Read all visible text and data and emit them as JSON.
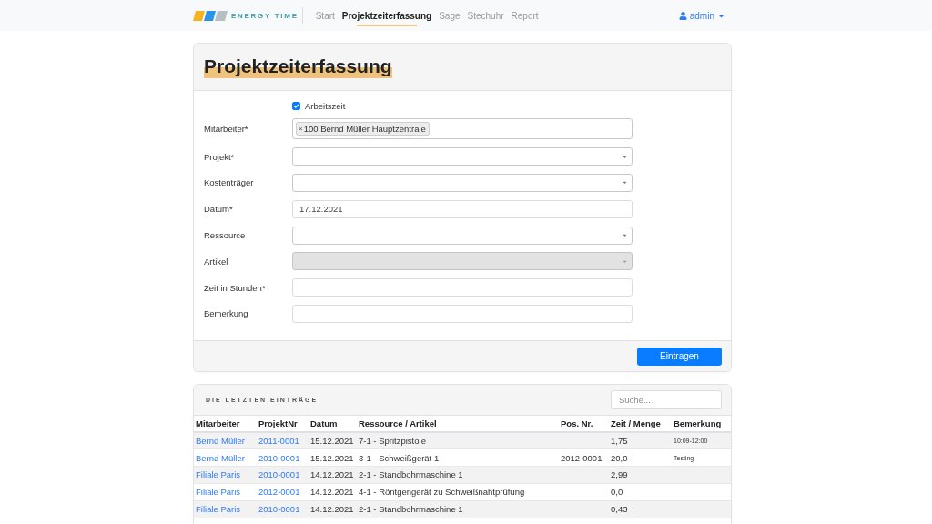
{
  "navbar": {
    "brand": "ENERGY TIME",
    "links": [
      {
        "label": "Start",
        "selected": false
      },
      {
        "label": "Projektzeiterfassung",
        "selected": true
      },
      {
        "label": "Sage",
        "selected": false
      },
      {
        "label": "Stechuhr",
        "selected": false
      },
      {
        "label": "Report",
        "selected": false
      }
    ],
    "user": "admin"
  },
  "form": {
    "title": "Projektzeiterfassung",
    "checkbox": {
      "label": "Arbeitszeit",
      "checked": true
    },
    "fields": [
      {
        "label": "Mitarbeiter*",
        "kind": "tags",
        "disabled": false,
        "tags": [
          {
            "remove": "×",
            "label": "100 Bernd Müller Hauptzentrale"
          }
        ]
      },
      {
        "label": "Projekt*",
        "kind": "select",
        "disabled": false
      },
      {
        "label": "Kostenträger",
        "kind": "select",
        "disabled": false
      },
      {
        "label": "Datum*",
        "kind": "text",
        "disabled": false,
        "value": "17.12.2021"
      },
      {
        "label": "Ressource",
        "kind": "select",
        "disabled": false
      },
      {
        "label": "Artikel",
        "kind": "select",
        "disabled": true
      },
      {
        "label": "Zeit in Stunden*",
        "kind": "text",
        "disabled": false
      },
      {
        "label": "Bemerkung",
        "kind": "text",
        "disabled": false
      }
    ],
    "submit": "Eintragen"
  },
  "recent": {
    "title": "DIE LETZTEN EINTRÄGE",
    "search": {
      "placeholder": "Suche..."
    },
    "table": {
      "columns": [
        {
          "label": "Mitarbeiter",
          "kind": "link"
        },
        {
          "label": "ProjektNr",
          "kind": "link"
        },
        {
          "label": "Datum",
          "kind": "text"
        },
        {
          "label": "Ressource / Artikel",
          "kind": "text"
        },
        {
          "label": "Pos. Nr.",
          "kind": "text"
        },
        {
          "label": "Zeit / Menge",
          "kind": "text"
        },
        {
          "label": "Bemerkung",
          "kind": "note"
        }
      ],
      "rows": [
        {
          "mitarbeiter": "Bernd Müller",
          "projekt_nr": "2011-0001",
          "datum": "15.12.2021",
          "ressource_artikel": "7-1 - Spritzpistole",
          "zeit_menge": "1,75",
          "bemerkung": "10:09-12:00"
        },
        {
          "mitarbeiter": "Bernd Müller",
          "projekt_nr": "2010-0001",
          "datum": "15.12.2021",
          "ressource_artikel": "3-1 - Schweißgerät 1",
          "pos_nr": "2012-0001",
          "zeit_menge": "20,0",
          "bemerkung": "Testing"
        },
        {
          "mitarbeiter": "Filiale Paris",
          "projekt_nr": "2010-0001",
          "datum": "14.12.2021",
          "ressource_artikel": "2-1 - Standbohrmaschine 1",
          "zeit_menge": "2,99"
        },
        {
          "mitarbeiter": "Filiale Paris",
          "projekt_nr": "2012-0001",
          "datum": "14.12.2021",
          "ressource_artikel": "4-1 - Röntgengerät zu Schweißnahtprüfung",
          "zeit_menge": "0,0"
        },
        {
          "mitarbeiter": "Filiale Paris",
          "projekt_nr": "2010-0001",
          "datum": "14.12.2021",
          "ressource_artikel": "2-1 - Standbohrmaschine 1",
          "zeit_menge": "0,43"
        }
      ]
    }
  }
}
